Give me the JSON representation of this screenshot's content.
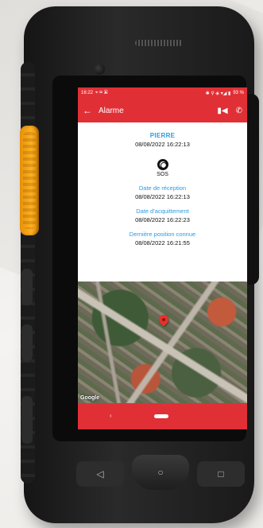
{
  "status_bar": {
    "time": "16:22",
    "left_icons": "⌖ ✉ ▣",
    "right_icons": "✱ ⚲ ◈ ▾◢ ▮",
    "battery": "93 %"
  },
  "app_bar": {
    "back": "←",
    "title": "Alarme",
    "action_icons": [
      "videocam-icon",
      "phone-icon"
    ]
  },
  "alarm": {
    "name": "PIERRE",
    "name_datetime": "08/08/2022 16:22:13",
    "type": "SOS",
    "reception_label": "Date de réception",
    "reception_value": "08/08/2022 16:22:13",
    "ack_label": "Date d'acquittement",
    "ack_value": "08/08/2022 16:22:23",
    "position_label": "Dernière position connue",
    "position_value": "08/08/2022 16:21:55"
  },
  "map": {
    "attribution": "Google"
  },
  "nav": {
    "back_chevron": "‹"
  },
  "hardware": {
    "back_key": "◁",
    "home_key": "○",
    "recents_key": "□"
  },
  "colors": {
    "accent_red": "#e03036",
    "label_blue": "#2b9be0",
    "ptt_orange": "#ffb01f"
  }
}
